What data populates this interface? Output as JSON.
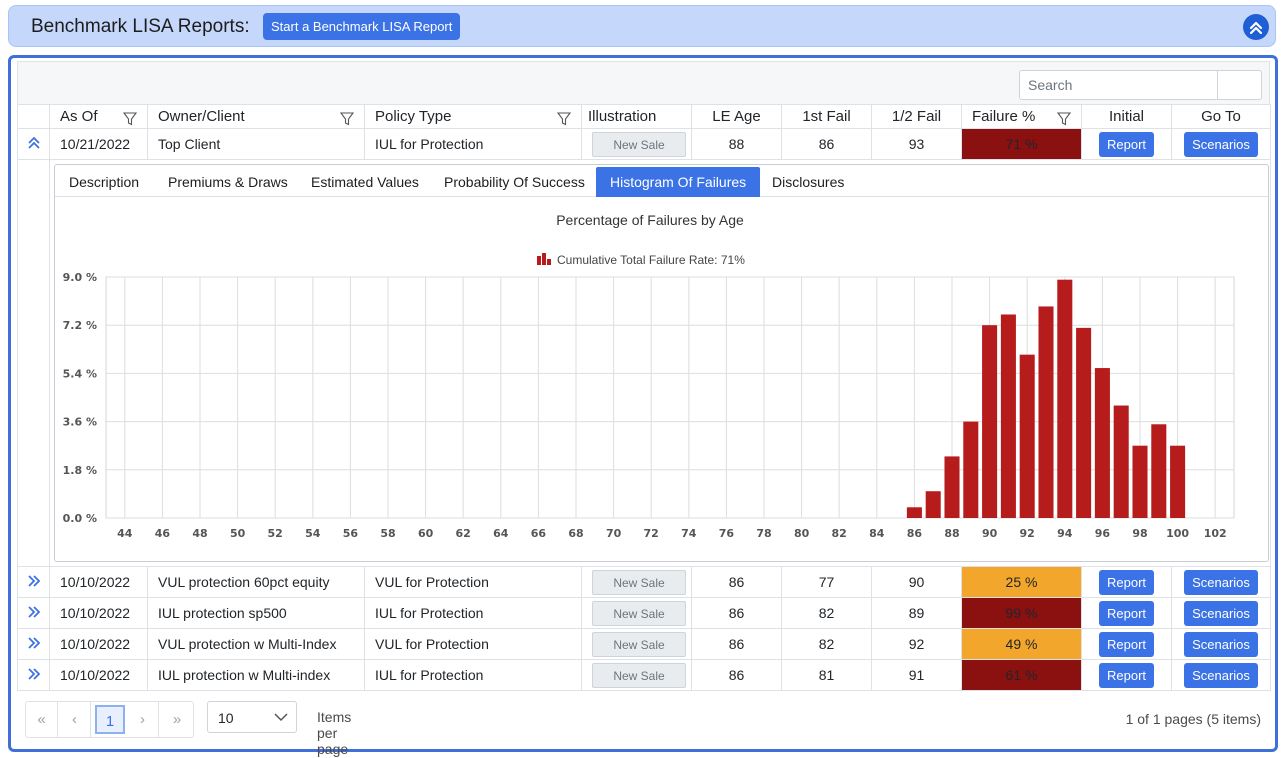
{
  "header": {
    "title": "Benchmark LISA Reports:",
    "start_button": "Start a Benchmark LISA Report"
  },
  "search": {
    "placeholder": "Search"
  },
  "columns": {
    "as_of": "As Of",
    "owner": "Owner/Client",
    "policy_type": "Policy Type",
    "illustration": "Illustration",
    "le_age": "LE Age",
    "first_fail": "1st Fail",
    "half_fail": "1/2 Fail",
    "failure_pct": "Failure %",
    "initial": "Initial",
    "go_to": "Go To"
  },
  "rows": [
    {
      "as_of": "10/21/2022",
      "owner": "Top Client",
      "policy_type": "IUL for Protection",
      "illustration": "New Sale",
      "le_age": "88",
      "first_fail": "86",
      "half_fail": "93",
      "failure_pct": "71 %",
      "initial": "Report",
      "go_to": "Scenarios"
    },
    {
      "as_of": "10/10/2022",
      "owner": "VUL protection 60pct equity",
      "policy_type": "VUL for Protection",
      "illustration": "New Sale",
      "le_age": "86",
      "first_fail": "77",
      "half_fail": "90",
      "failure_pct": "25 %",
      "initial": "Report",
      "go_to": "Scenarios"
    },
    {
      "as_of": "10/10/2022",
      "owner": "IUL protection sp500",
      "policy_type": "IUL for Protection",
      "illustration": "New Sale",
      "le_age": "86",
      "first_fail": "82",
      "half_fail": "89",
      "failure_pct": "99 %",
      "initial": "Report",
      "go_to": "Scenarios"
    },
    {
      "as_of": "10/10/2022",
      "owner": "VUL protection w Multi-Index",
      "policy_type": "VUL for Protection",
      "illustration": "New Sale",
      "le_age": "86",
      "first_fail": "82",
      "half_fail": "92",
      "failure_pct": "49 %",
      "initial": "Report",
      "go_to": "Scenarios"
    },
    {
      "as_of": "10/10/2022",
      "owner": "IUL protection w Multi-index",
      "policy_type": "IUL for Protection",
      "illustration": "New Sale",
      "le_age": "86",
      "first_fail": "81",
      "half_fail": "91",
      "failure_pct": "61 %",
      "initial": "Report",
      "go_to": "Scenarios"
    }
  ],
  "tabs": [
    "Description",
    "Premiums & Draws",
    "Estimated Values",
    "Probability Of Success",
    "Histogram Of Failures",
    "Disclosures"
  ],
  "pager": {
    "first": "«",
    "prev": "‹",
    "current": "1",
    "next": "›",
    "last": "»",
    "page_size": "10",
    "items_per_page": "Items per page",
    "info": "1 of 1 pages (5 items)"
  },
  "colors": {
    "accent": "#3b73e6",
    "fail_high": "#8b1111",
    "fail_mid": "#f3a62c",
    "bar": "#b71c1c"
  },
  "chart_data": {
    "type": "bar",
    "title": "Percentage of Failures by Age",
    "legend": "Cumulative Total Failure Rate: 71%",
    "legend_position": "top",
    "x_ticks": [
      "44",
      "46",
      "48",
      "50",
      "52",
      "54",
      "56",
      "58",
      "60",
      "62",
      "64",
      "66",
      "68",
      "70",
      "72",
      "74",
      "76",
      "78",
      "80",
      "82",
      "84",
      "86",
      "88",
      "90",
      "92",
      "94",
      "96",
      "98",
      "100",
      "102"
    ],
    "y_ticks": [
      "0.0 %",
      "1.8 %",
      "3.6 %",
      "5.4 %",
      "7.2 %",
      "9.0 %"
    ],
    "xlim": [
      43,
      103
    ],
    "ylim": [
      0,
      9.0
    ],
    "grid": true,
    "x": [
      86,
      87,
      88,
      89,
      90,
      91,
      92,
      93,
      94,
      95,
      96,
      97,
      98,
      99,
      100
    ],
    "values": [
      0.4,
      1.0,
      2.3,
      3.6,
      7.2,
      7.6,
      6.1,
      7.9,
      8.9,
      7.1,
      5.6,
      4.2,
      2.7,
      3.5,
      2.7
    ]
  }
}
